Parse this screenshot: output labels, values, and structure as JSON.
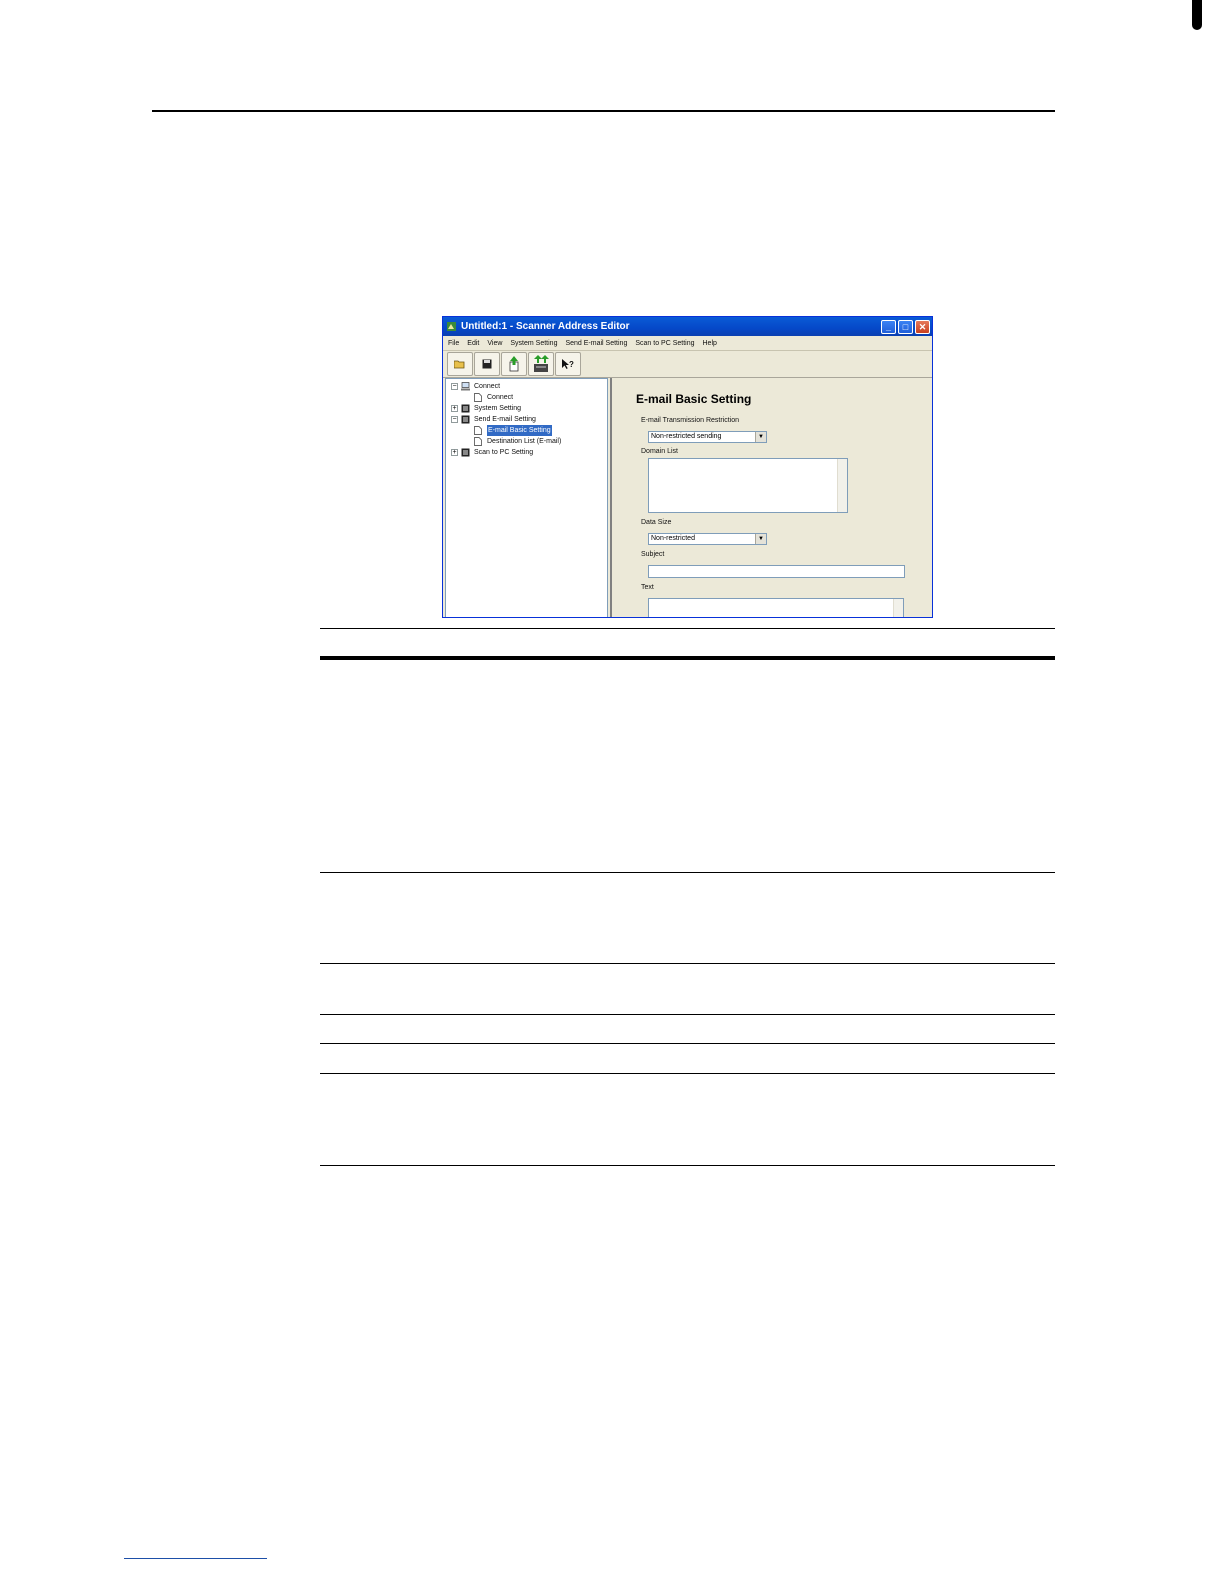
{
  "window": {
    "title": "Untitled:1 - Scanner Address Editor",
    "minimize_label": "_",
    "maximize_label": "□",
    "close_label": "✕"
  },
  "menu": [
    "File",
    "Edit",
    "View",
    "System Setting",
    "Send E-mail Setting",
    "Scan to PC Setting",
    "Help"
  ],
  "toolbar": {
    "buttons": [
      "open-icon",
      "save-icon",
      "upload-icon",
      "transfer-icon",
      "help-icon"
    ]
  },
  "tree": {
    "connect": "Connect",
    "connect_child": "Connect",
    "system_setting": "System Setting",
    "send_email_setting": "Send E-mail Setting",
    "email_basic_setting": "E-mail Basic Setting",
    "destination_list": "Destination List (E-mail)",
    "scan_to_pc_setting": "Scan to PC Setting"
  },
  "pane": {
    "title": "E-mail Basic Setting",
    "restriction_label": "E-mail Transmission Restriction",
    "restriction_value": "Non-restricted sending",
    "domain_list_label": "Domain List",
    "data_size_label": "Data Size",
    "data_size_value": "Non-restricted",
    "subject_label": "Subject",
    "subject_value": "",
    "text_label": "Text"
  }
}
